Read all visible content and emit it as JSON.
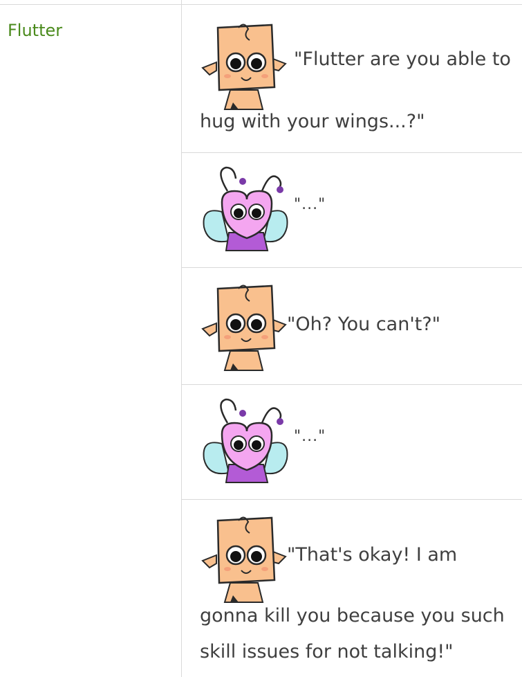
{
  "speaker": {
    "name": "Flutter"
  },
  "dialogue": [
    {
      "character": "cube-character",
      "line1": "\"Flutter are you able to",
      "line2": "hug with your wings...?\""
    },
    {
      "character": "butterfly-character",
      "line1": "\"...\""
    },
    {
      "character": "cube-character",
      "line1": "\"Oh? You can't?\""
    },
    {
      "character": "butterfly-character",
      "line1": "\"...\""
    },
    {
      "character": "cube-character",
      "line1": "\"That's okay! I am",
      "line2": "gonna kill you because you such",
      "line3": "skill issues for not talking!\""
    }
  ],
  "colors": {
    "speaker_name": "#4a8a1c",
    "divider": "#d9d9d9",
    "cube_skin": "#f9c08e",
    "butterfly_head": "#f4a6f0",
    "butterfly_wings": "#b8ecef",
    "butterfly_body": "#b35bd6"
  }
}
